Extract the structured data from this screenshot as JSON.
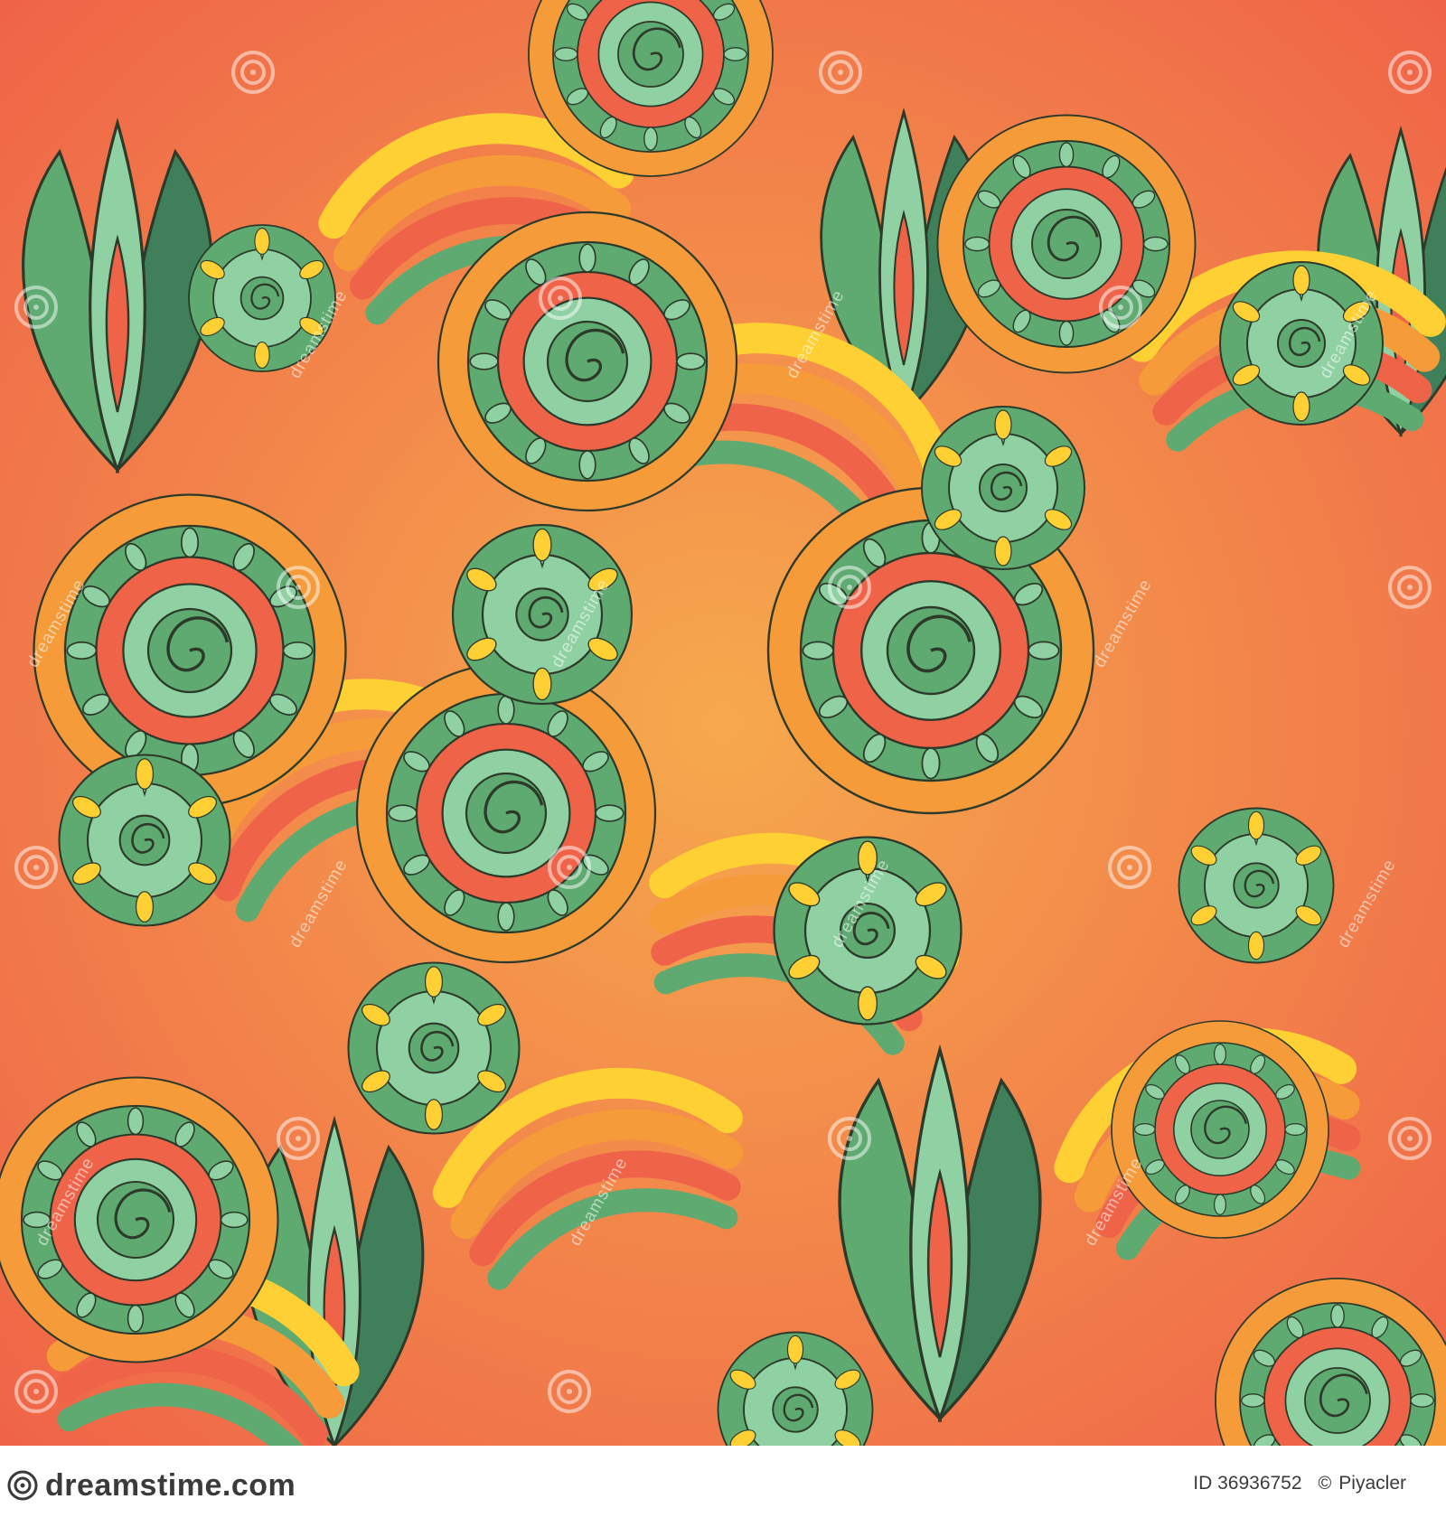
{
  "watermark": {
    "label": "dreamstime",
    "color": "#ffffff"
  },
  "footer": {
    "logo_text": "dreamstime.com",
    "logo_icon": "dreamstime-spiral-icon",
    "id_label": "ID 36936752",
    "copyright_icon": "copyright-icon",
    "author": "Piyacler"
  },
  "palette": {
    "red": "#ef6448",
    "orange": "#f59b3a",
    "light_orange": "#f6a94d",
    "yellow": "#ffd033",
    "green": "#5eaa70",
    "dark_green": "#3f7f59",
    "mint": "#8fd1a3",
    "outline": "#2d3a2a"
  }
}
